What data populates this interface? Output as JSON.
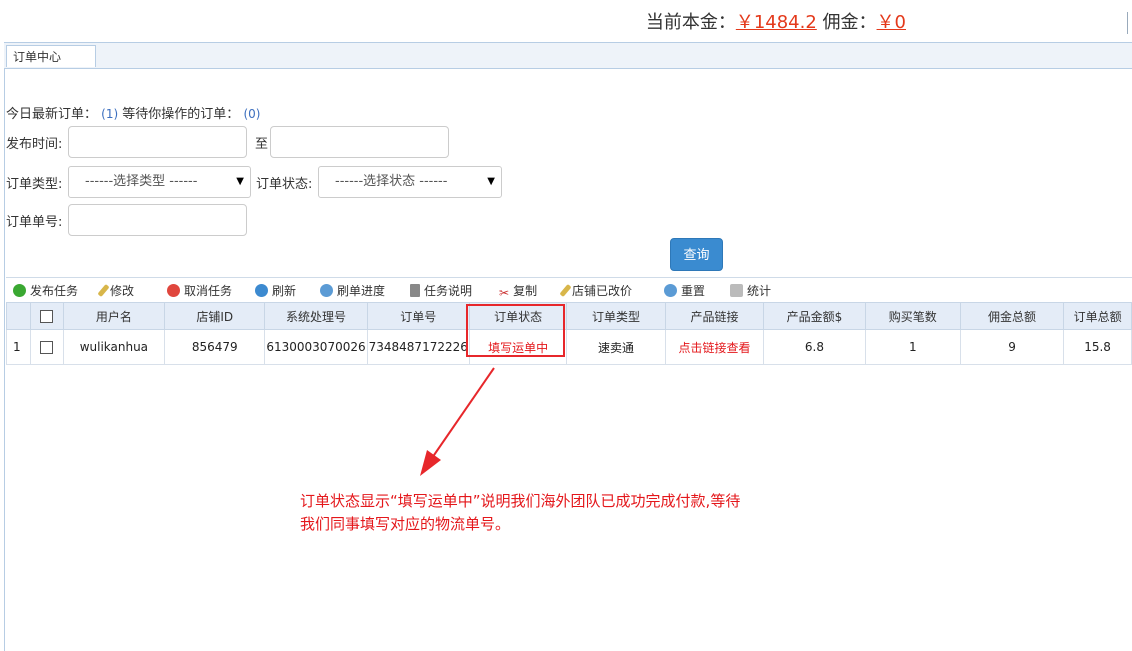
{
  "header": {
    "principal_label": "当前本金：",
    "principal_value": "￥1484.2",
    "commission_label": "佣金：",
    "commission_value": "￥0"
  },
  "tabs": [
    {
      "label": "订单中心"
    }
  ],
  "summary": {
    "today_label": "今日最新订单：",
    "today_count": "(1)",
    "pending_label": "等待你操作的订单：",
    "pending_count": "(0)"
  },
  "filters": {
    "publish_time_label": "发布时间:",
    "to_label": "至",
    "order_type_label": "订单类型:",
    "order_type_value": "------选择类型 ------",
    "order_status_label": "订单状态:",
    "order_status_value": "------选择状态 ------",
    "order_no_label": "订单单号:",
    "query_button": "查询"
  },
  "toolbar": [
    {
      "label": "发布任务",
      "icon": "add-icon"
    },
    {
      "label": "修改",
      "icon": "pencil-icon"
    },
    {
      "label": "取消任务",
      "icon": "cancel-icon"
    },
    {
      "label": "刷新",
      "icon": "refresh-icon"
    },
    {
      "label": "刷单进度",
      "icon": "progress-icon"
    },
    {
      "label": "任务说明",
      "icon": "document-icon"
    },
    {
      "label": "复制",
      "icon": "scissors-icon"
    },
    {
      "label": "店铺已改价",
      "icon": "pencil-icon"
    },
    {
      "label": "重置",
      "icon": "reset-icon"
    },
    {
      "label": "统计",
      "icon": "stats-icon"
    }
  ],
  "table": {
    "columns": [
      "用户名",
      "店铺ID",
      "系统处理号",
      "订单号",
      "订单状态",
      "订单类型",
      "产品链接",
      "产品金额$",
      "购买笔数",
      "佣金总额",
      "订单总额"
    ],
    "rows": [
      {
        "index": "1",
        "cells": [
          "wulikanhua",
          "856479",
          "6130003070026",
          "7348487172226",
          "填写运单中",
          "速卖通",
          "点击链接查看",
          "6.8",
          "1",
          "9",
          "15.8"
        ]
      }
    ]
  },
  "annotation": {
    "text_line1": "订单状态显示“填写运单中”说明我们海外团队已成功完成付款,等待",
    "text_line2": "我们同事填写对应的物流单号。"
  },
  "colors": {
    "accent_red": "#e4171b",
    "header_blue": "#e4ecf7",
    "query_button": "#3a8bd0"
  }
}
